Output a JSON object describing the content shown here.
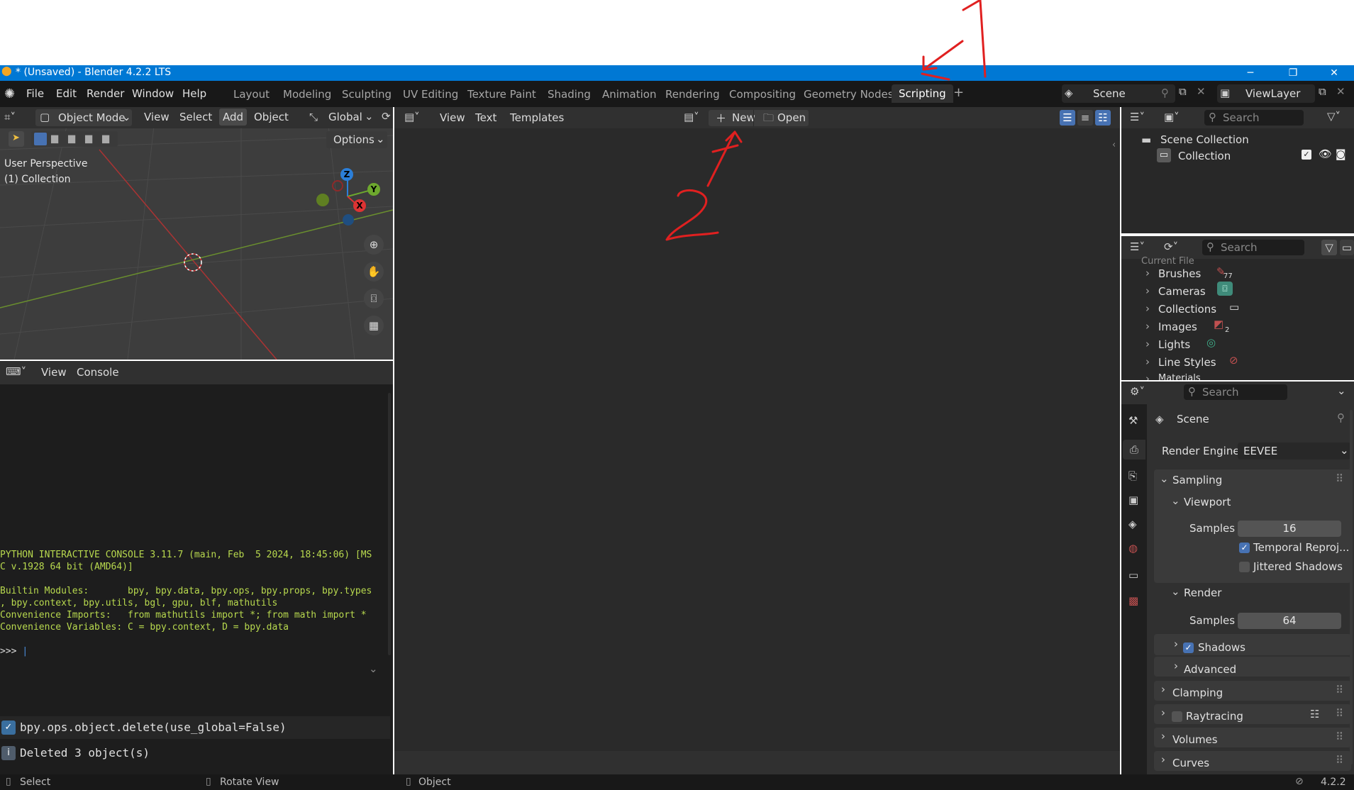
{
  "window": {
    "title": "* (Unsaved) - Blender 4.2.2 LTS",
    "minimize": "─",
    "maximize": "❐",
    "close": "✕"
  },
  "menu": [
    "File",
    "Edit",
    "Render",
    "Window",
    "Help"
  ],
  "workspaces": [
    "Layout",
    "Modeling",
    "Sculpting",
    "UV Editing",
    "Texture Paint",
    "Shading",
    "Animation",
    "Rendering",
    "Compositing",
    "Geometry Nodes",
    "Scripting"
  ],
  "active_workspace": "Scripting",
  "add_workspace": "+",
  "scene": {
    "name": "Scene",
    "viewlayer": "ViewLayer"
  },
  "viewport": {
    "mode": "Object Mode",
    "menus": [
      "View",
      "Select",
      "Add",
      "Object"
    ],
    "transform": "Global",
    "options": "Options",
    "perspective": "User Perspective",
    "collection": "(1) Collection",
    "gizmo": {
      "z": "Z",
      "y": "Y",
      "x": "X"
    }
  },
  "console": {
    "menus": [
      "View",
      "Console"
    ],
    "lines": [
      "PYTHON INTERACTIVE CONSOLE 3.11.7 (main, Feb  5 2024, 18:45:06) [MS",
      "C v.1928 64 bit (AMD64)]",
      "",
      "Builtin Modules:       bpy, bpy.data, bpy.ops, bpy.props, bpy.types",
      ", bpy.context, bpy.utils, bgl, gpu, blf, mathutils",
      "Convenience Imports:   from mathutils import *; from math import *",
      "Convenience Variables: C = bpy.context, D = bpy.data"
    ],
    "prompt": ">>> "
  },
  "info": {
    "op": "bpy.ops.object.delete(use_global=False)",
    "msg": "Deleted 3 object(s)"
  },
  "text_editor": {
    "menus": [
      "View",
      "Text",
      "Templates"
    ],
    "new": "New",
    "open": "Open"
  },
  "outliner": {
    "search": "Search",
    "scene_collection": "Scene Collection",
    "collection": "Collection"
  },
  "blend_file": {
    "search": "Search",
    "partial_top": "Current File",
    "items": [
      {
        "label": "Brushes",
        "badge": "77"
      },
      {
        "label": "Cameras",
        "badge": ""
      },
      {
        "label": "Collections",
        "badge": ""
      },
      {
        "label": "Images",
        "badge": "2"
      },
      {
        "label": "Lights",
        "badge": ""
      },
      {
        "label": "Line Styles",
        "badge": ""
      }
    ],
    "partial_bottom": "Materials"
  },
  "properties": {
    "search": "Search",
    "context": "Scene",
    "render_engine_label": "Render Engine",
    "render_engine": "EEVEE",
    "sampling": "Sampling",
    "viewport": "Viewport",
    "samples_label": "Samples",
    "viewport_samples": "16",
    "temporal": "Temporal Reproj...",
    "jittered": "Jittered Shadows",
    "render": "Render",
    "render_samples": "64",
    "shadows": "Shadows",
    "advanced": "Advanced",
    "clamping": "Clamping",
    "raytracing": "Raytracing",
    "volumes": "Volumes",
    "curves": "Curves"
  },
  "status": {
    "select": "Select",
    "rotate": "Rotate View",
    "object": "Object",
    "version": "4.2.2"
  },
  "annotations": {
    "one": "1",
    "two": "2"
  },
  "colors": {
    "accent": "#4772b3",
    "titlebar": "#0078d4",
    "annotation": "#e02020",
    "console_text": "#b8d94e"
  }
}
